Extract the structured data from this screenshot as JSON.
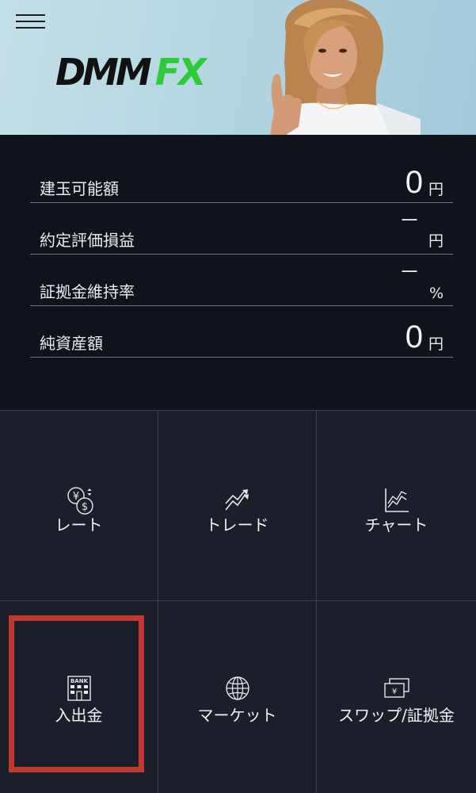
{
  "header": {
    "logo_primary": "DMM",
    "logo_secondary": "FX"
  },
  "summary": [
    {
      "label": "建玉可能額",
      "value": "0",
      "unit": "円"
    },
    {
      "label": "約定評価損益",
      "value": "－",
      "unit": "円"
    },
    {
      "label": "証拠金維持率",
      "value": "－",
      "unit": "%"
    },
    {
      "label": "純資産額",
      "value": "0",
      "unit": "円"
    }
  ],
  "menu": [
    {
      "label": "レート",
      "icon": "currency-exchange-icon"
    },
    {
      "label": "トレード",
      "icon": "trade-chart-icon"
    },
    {
      "label": "チャート",
      "icon": "chart-icon"
    },
    {
      "label": "入出金",
      "icon": "bank-icon",
      "icon_text": "BANK"
    },
    {
      "label": "マーケット",
      "icon": "globe-icon"
    },
    {
      "label": "スワップ/証拠金",
      "icon": "yen-cards-icon",
      "icon_text": "¥"
    }
  ],
  "colors": {
    "header_bg": "#b4d6e2",
    "logo_dark": "#111111",
    "logo_green": "#2ccb3a",
    "summary_bg": "#0f141c",
    "grid_bg": "#1a1f29",
    "highlight": "#c0392f"
  }
}
